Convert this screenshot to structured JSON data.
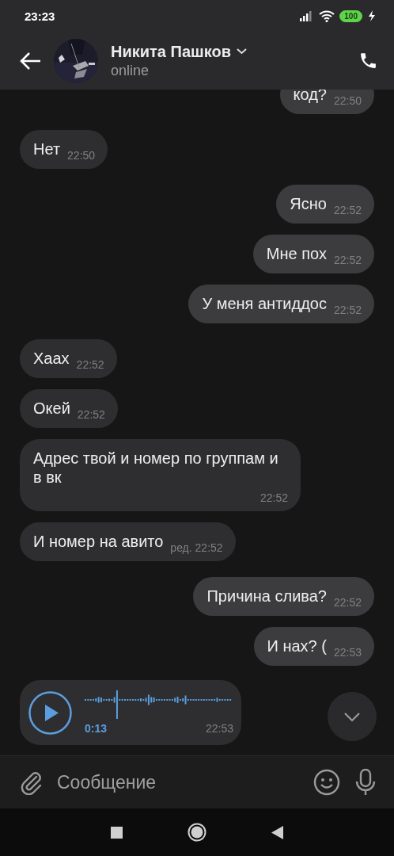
{
  "status_bar": {
    "time": "23:23",
    "battery": "100"
  },
  "header": {
    "name": "Никита Пашков",
    "status": "online"
  },
  "messages": [
    {
      "kind": "outgoing",
      "text": "код?",
      "time": "22:50"
    },
    {
      "kind": "incoming",
      "text": "Нет",
      "time": "22:50"
    },
    {
      "kind": "outgoing",
      "text": "Ясно",
      "time": "22:52"
    },
    {
      "kind": "outgoing",
      "text": "Мне пох",
      "time": "22:52"
    },
    {
      "kind": "outgoing",
      "text": "У меня антиддос",
      "time": "22:52"
    },
    {
      "kind": "incoming",
      "text": "Хаах",
      "time": "22:52"
    },
    {
      "kind": "incoming",
      "text": "Окей",
      "time": "22:52"
    },
    {
      "kind": "incoming",
      "text": "Адрес твой и номер по группам и в вк",
      "time": "22:52"
    },
    {
      "kind": "incoming",
      "text": "И номер на авито",
      "time": "22:52",
      "edited": "ред."
    },
    {
      "kind": "outgoing",
      "text": "Причина слива?",
      "time": "22:52"
    },
    {
      "kind": "outgoing",
      "text": "И нах? (",
      "time": "22:53"
    },
    {
      "kind": "voice",
      "duration": "0:13",
      "time": "22:53"
    }
  ],
  "composer": {
    "placeholder": "Сообщение"
  }
}
